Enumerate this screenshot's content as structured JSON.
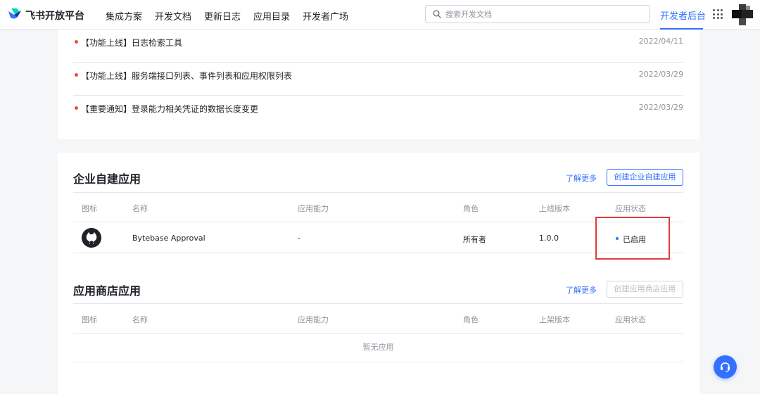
{
  "header": {
    "brand": "飞书开放平台",
    "nav": [
      "集成方案",
      "开发文档",
      "更新日志",
      "应用目录",
      "开发者广场"
    ],
    "search_placeholder": "搜索开发文档",
    "console_label": "开发者后台"
  },
  "news": [
    {
      "title": "【功能上线】日志检索工具",
      "date": "2022/04/11"
    },
    {
      "title": "【功能上线】服务端接口列表、事件列表和应用权限列表",
      "date": "2022/03/29"
    },
    {
      "title": "【重要通知】登录能力相关凭证的数据长度变更",
      "date": "2022/03/29"
    }
  ],
  "custom_apps": {
    "title": "企业自建应用",
    "more_label": "了解更多",
    "create_label": "创建企业自建应用",
    "columns": [
      "图标",
      "名称",
      "应用能力",
      "角色",
      "上线版本",
      "应用状态"
    ],
    "rows": [
      {
        "name": "Bytebase Approval",
        "capability": "-",
        "role": "所有者",
        "version": "1.0.0",
        "status": "已启用"
      }
    ]
  },
  "store_apps": {
    "title": "应用商店应用",
    "more_label": "了解更多",
    "create_label": "创建应用商店应用",
    "columns": [
      "图标",
      "名称",
      "应用能力",
      "角色",
      "上架版本",
      "应用状态"
    ],
    "empty_text": "暂无应用"
  },
  "colors": {
    "accent": "#3370ff",
    "news_dot": "#f54a45",
    "highlight_border": "#e03b3b"
  }
}
